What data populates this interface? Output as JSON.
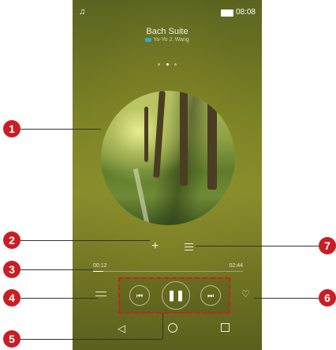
{
  "status_bar": {
    "time": "08:08",
    "left_icon": "music-note-icon"
  },
  "now_playing": {
    "song_title": "Bach Suite",
    "artist": "Yo-Yo J. Wang",
    "page_indicator": {
      "count": 3,
      "active_index": 1
    }
  },
  "actions": {
    "add_icon": "plus-icon",
    "queue_icon": "menu-lines-icon"
  },
  "progress": {
    "elapsed": "00:12",
    "total": "02:44",
    "fraction": 0.07
  },
  "controls": {
    "shuffle_icon": "shuffle-icon",
    "prev_icon": "skip-previous-icon",
    "pause_icon": "pause-icon",
    "next_icon": "skip-next-icon",
    "favorite_icon": "heart-icon"
  },
  "navbar": {
    "back": "back-icon",
    "home": "home-icon",
    "recent": "recent-apps-icon"
  },
  "callouts": [
    "1",
    "2",
    "3",
    "4",
    "5",
    "6",
    "7"
  ],
  "colors": {
    "callout": "#c81e24",
    "highlight_border": "#cc1e25"
  }
}
